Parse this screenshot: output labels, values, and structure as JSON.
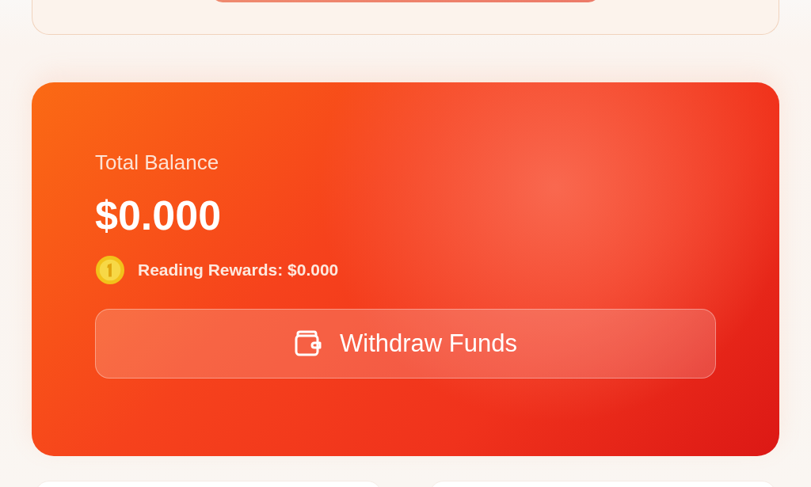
{
  "balance_card": {
    "label": "Total Balance",
    "amount": "$0.000",
    "rewards": "Reading Rewards: $0.000",
    "withdraw_button": "Withdraw Funds"
  }
}
